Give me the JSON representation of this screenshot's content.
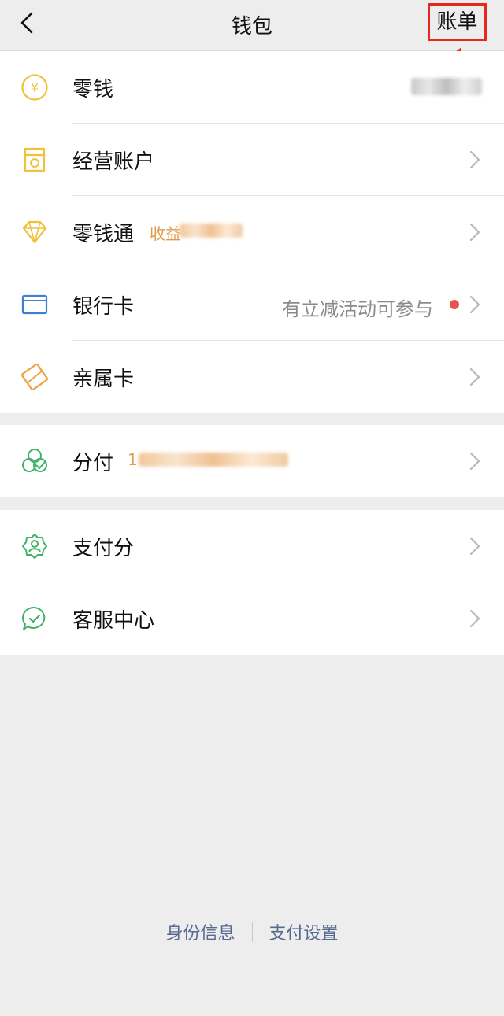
{
  "header": {
    "title": "钱包",
    "bill_label": "账单"
  },
  "groups": [
    {
      "items": [
        {
          "label": "零钱",
          "icon": "yuan-coin-icon"
        },
        {
          "label": "经营账户",
          "icon": "shop-icon"
        },
        {
          "label": "零钱通",
          "icon": "diamond-icon",
          "badge_prefix": "收益"
        },
        {
          "label": "银行卡",
          "icon": "bank-card-icon",
          "hint": "有立减活动可参与"
        },
        {
          "label": "亲属卡",
          "icon": "family-card-icon"
        }
      ]
    },
    {
      "items": [
        {
          "label": "分付",
          "icon": "fenfu-icon",
          "badge_prefix": "1"
        }
      ]
    },
    {
      "items": [
        {
          "label": "支付分",
          "icon": "pay-score-icon"
        },
        {
          "label": "客服中心",
          "icon": "customer-service-icon"
        }
      ]
    }
  ],
  "footer": {
    "identity_label": "身份信息",
    "settings_label": "支付设置"
  },
  "colors": {
    "background": "#ededed",
    "accent_gold": "#f0c23b",
    "accent_blue": "#3d7fd6",
    "accent_green": "#3fb36a",
    "highlight_red": "#e8271e",
    "link": "#57698f"
  }
}
